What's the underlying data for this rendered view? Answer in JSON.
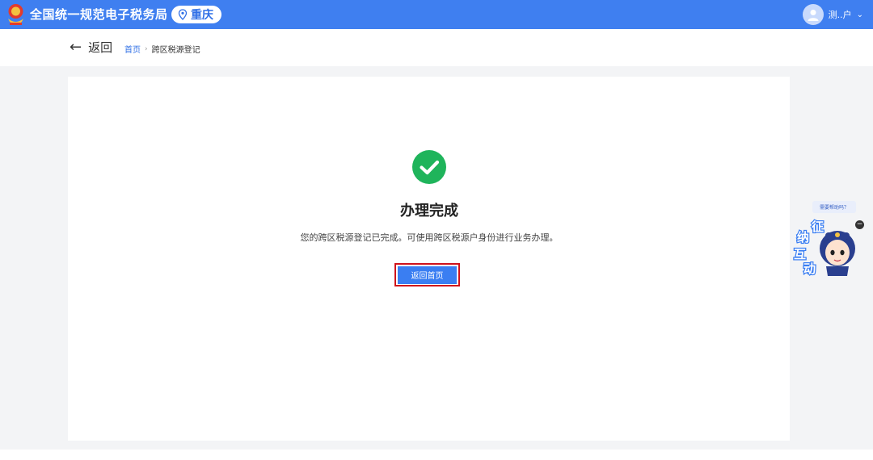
{
  "header": {
    "app_title": "全国统一规范电子税务局",
    "region": "重庆",
    "user_name": "测..户",
    "user_caret": "⌄"
  },
  "nav": {
    "back_label": "返回",
    "breadcrumb": {
      "home": "首页",
      "separator": "›",
      "current": "跨区税源登记"
    }
  },
  "result": {
    "title": "办理完成",
    "message": "您的跨区税源登记已完成。可使用跨区税源户身份进行业务办理。",
    "button_label": "返回首页"
  },
  "assistant": {
    "help_text": "需要帮助吗？",
    "close_glyph": "−",
    "badge_chars": [
      "征",
      "纳",
      "互",
      "动"
    ]
  },
  "colors": {
    "primary": "#3f7ff0",
    "success": "#1fb45b",
    "highlight_border": "#d0121b"
  }
}
